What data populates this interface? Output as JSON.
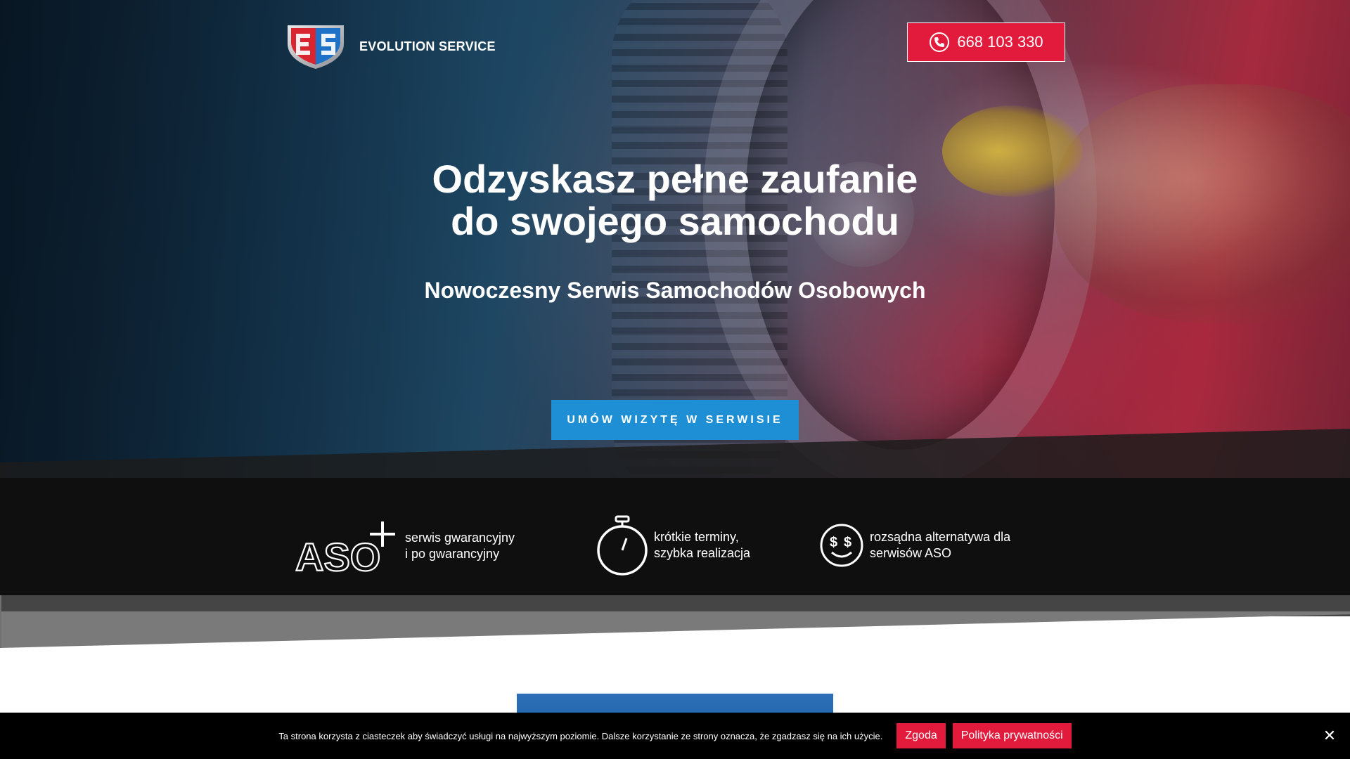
{
  "brand": {
    "name": "EVOLUTION SERVICE"
  },
  "header": {
    "phone_label": "668 103 330"
  },
  "hero": {
    "headline_line1": "Odzyskasz pełne zaufanie",
    "headline_line2": "do swojego samochodu",
    "subheadline": "Nowoczesny Serwis Samochodów Osobowych",
    "cta_label": "UMÓW WIZYTĘ W SERWISIE"
  },
  "features": [
    {
      "icon": "aso-plus-icon",
      "icon_text": "ASO",
      "line1": "serwis gwarancyjny",
      "line2": "i po gwarancyjny"
    },
    {
      "icon": "stopwatch-icon",
      "line1": "krótkie terminy,",
      "line2": "szybka realizacja"
    },
    {
      "icon": "dollar-smile-icon",
      "line1": "rozsądna alternatywa dla",
      "line2": "serwisów ASO"
    }
  ],
  "cookie": {
    "text": "Ta strona korzysta z ciasteczek aby świadczyć usługi na najwyższym poziomie. Dalsze korzystanie ze strony oznacza, że zgadzasz się na ich użycie.",
    "accept_label": "Zgoda",
    "privacy_label": "Polityka prywatności",
    "close_icon": "close-icon"
  },
  "colors": {
    "accent_red": "#e21b3c",
    "accent_blue": "#1e8fd5",
    "dark_band": "#0f0f10"
  }
}
